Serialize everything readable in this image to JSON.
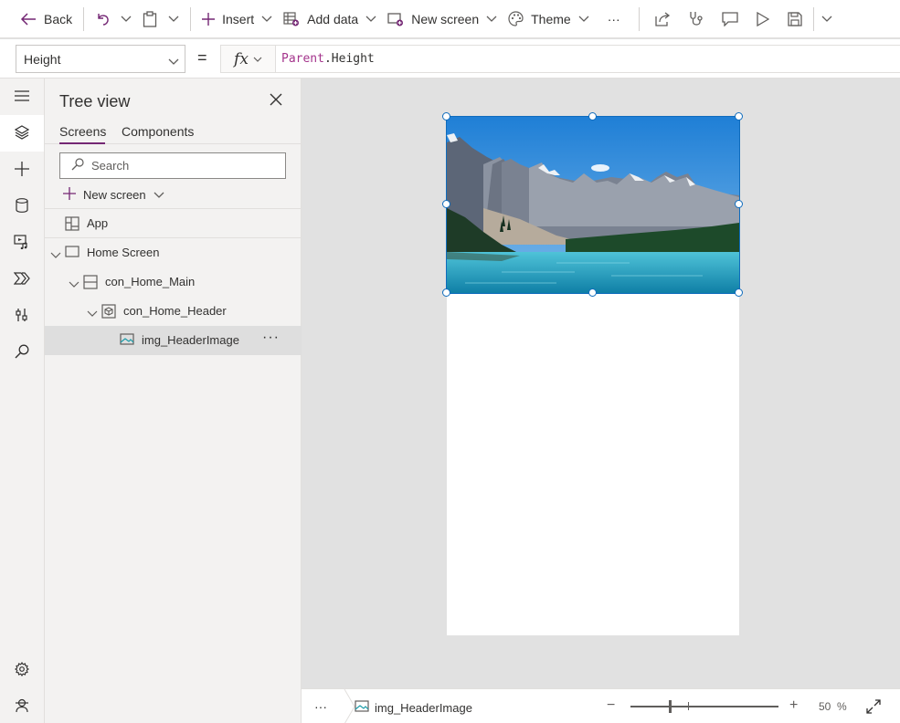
{
  "toolbar": {
    "back_label": "Back",
    "insert_label": "Insert",
    "add_data_label": "Add data",
    "new_screen_label": "New screen",
    "theme_label": "Theme",
    "more_label": "···"
  },
  "formula_bar": {
    "property": "Height",
    "equals": "=",
    "fx": "fx",
    "formula_object": "Parent",
    "formula_property": ".Height"
  },
  "tree_view": {
    "title": "Tree view",
    "tabs": [
      {
        "label": "Screens",
        "active": true
      },
      {
        "label": "Components",
        "active": false
      }
    ],
    "search_placeholder": "Search",
    "new_screen_label": "New screen",
    "items": [
      {
        "label": "App",
        "icon": "app-icon",
        "level": 0,
        "selected": false
      },
      {
        "label": "Home Screen",
        "icon": "screen-icon",
        "level": 0,
        "expanded": true,
        "selected": false
      },
      {
        "label": "con_Home_Main",
        "icon": "vertical-container-icon",
        "level": 1,
        "expanded": true,
        "selected": false
      },
      {
        "label": "con_Home_Header",
        "icon": "container-icon",
        "level": 2,
        "expanded": true,
        "selected": false
      },
      {
        "label": "img_HeaderImage",
        "icon": "image-icon",
        "level": 3,
        "selected": true,
        "more": "···"
      }
    ]
  },
  "status_bar": {
    "more_label": "···",
    "selected_item": "img_HeaderImage",
    "zoom_value": "50",
    "zoom_unit": "%",
    "zoom_minus": "−",
    "zoom_plus": "+"
  },
  "colors": {
    "accent": "#742774",
    "selection": "#0f6cbd",
    "formula_object": "#a4348c"
  }
}
